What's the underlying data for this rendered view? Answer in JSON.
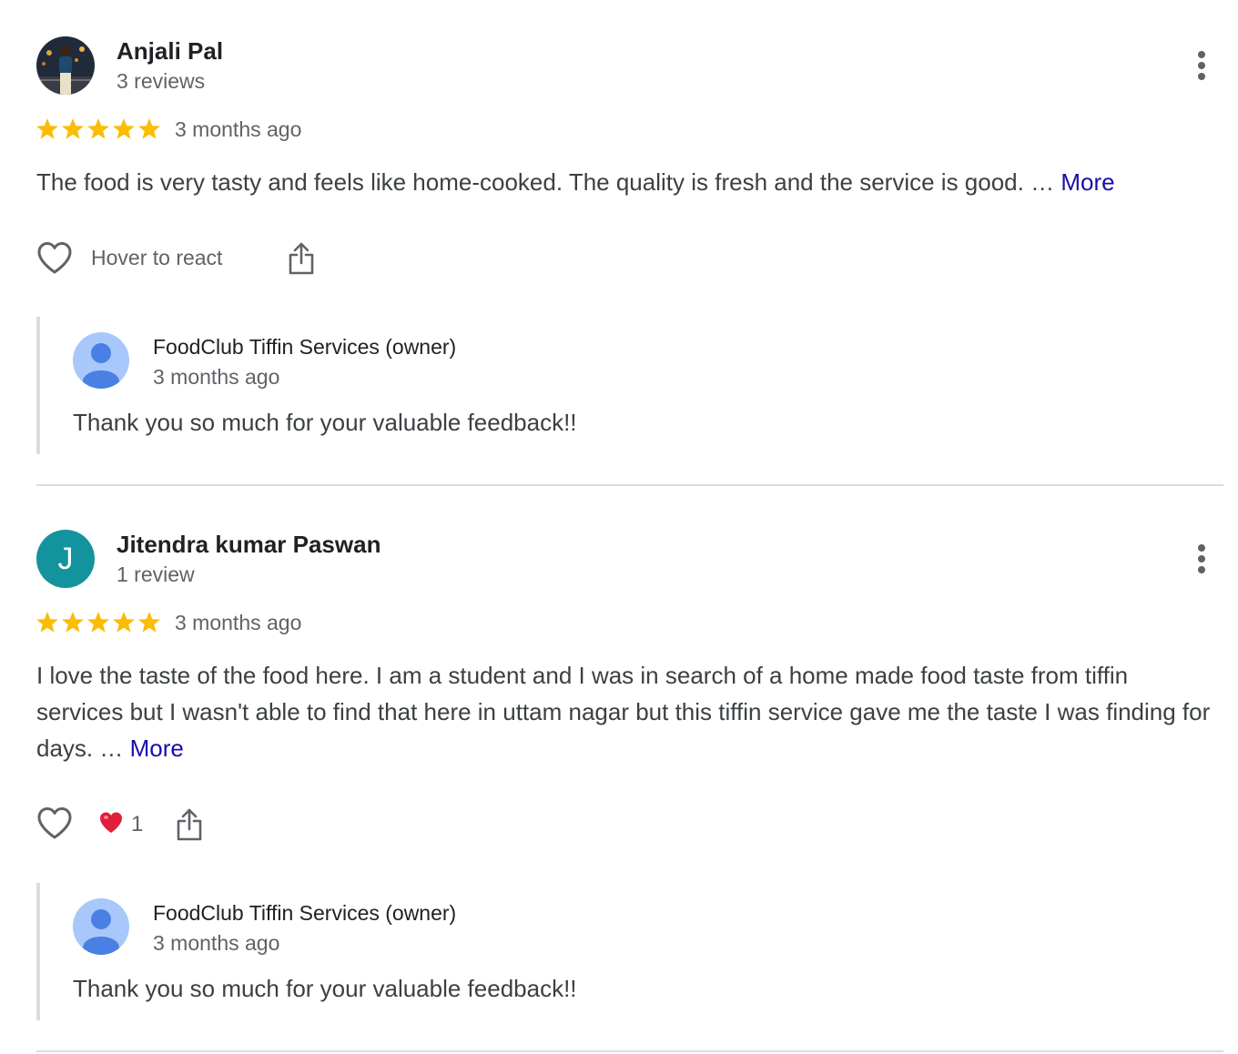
{
  "reviews": [
    {
      "author": "Anjali Pal",
      "review_count": "3 reviews",
      "rating": 5,
      "time": "3 months ago",
      "text": "The food is very tasty and feels like home-cooked. The quality is fresh and the service is good. …",
      "more_label": "More",
      "react_label": "Hover to react",
      "owner_reply": {
        "name": "FoodClub Tiffin Services (owner)",
        "time": "3 months ago",
        "text": "Thank you so much for your valuable feedback!!"
      }
    },
    {
      "author": "Jitendra kumar Paswan",
      "avatar_letter": "J",
      "review_count": "1 review",
      "rating": 5,
      "time": "3 months ago",
      "text": "I love the taste of the food here. I am a student and I was in search of a home made food taste from tiffin services but I wasn't able to find that here in uttam nagar but this tiffin service gave me the taste I was finding for days. …",
      "more_label": "More",
      "reaction_count": "1",
      "owner_reply": {
        "name": "FoodClub Tiffin Services (owner)",
        "time": "3 months ago",
        "text": "Thank you so much for your valuable feedback!!"
      }
    }
  ],
  "colors": {
    "star": "#fbbc04",
    "link": "#1a0dab",
    "letter_avatar": "#13939e",
    "owner_avatar_bg": "#a8c7fa",
    "owner_avatar_fg": "#4a7fe3",
    "divider": "#dadce0"
  },
  "icons": [
    "more-vert-icon",
    "heart-outline-icon",
    "share-icon",
    "red-heart-emoji-icon",
    "star-icon",
    "person-icon"
  ]
}
